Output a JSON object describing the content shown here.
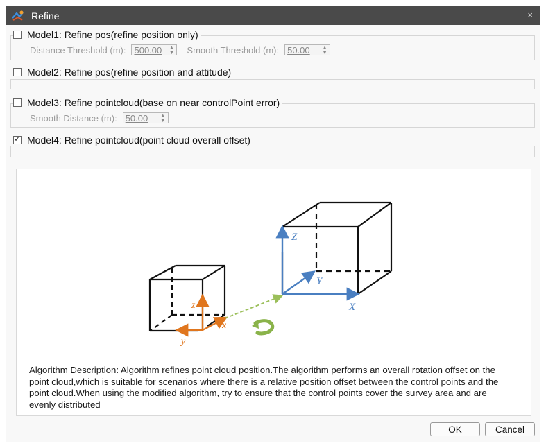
{
  "window": {
    "title": "Refine",
    "close_glyph": "×"
  },
  "models": [
    {
      "label": "Model1: Refine pos(refine position only)",
      "checked": false
    },
    {
      "label": "Model2: Refine pos(refine position and attitude)",
      "checked": false
    },
    {
      "label": "Model3: Refine pointcloud(base on near controlPoint error)",
      "checked": false
    },
    {
      "label": "Model4: Refine pointcloud(point cloud overall offset)",
      "checked": true
    }
  ],
  "model1": {
    "distance_label": "Distance Threshold (m):",
    "distance_value": "500.00",
    "smooth_label": "Smooth Threshold (m):",
    "smooth_value": "50.00"
  },
  "model3": {
    "smooth_distance_label": "Smooth Distance (m):",
    "smooth_distance_value": "50.00"
  },
  "diagram": {
    "large_cube_axes": {
      "x": "X",
      "y": "Y",
      "z": "Z",
      "color": "#4a7fc1"
    },
    "small_cube_axes": {
      "x": "x",
      "y": "y",
      "z": "z",
      "color": "#e0761e"
    },
    "offset_arrow_color": "#9bbf5a",
    "rotation_icon": "curved-arrow-icon"
  },
  "description": "Algorithm Description: Algorithm refines point cloud position.The algorithm performs an overall rotation offset on the point cloud,which is suitable for scenarios where there is a relative position offset between the control points and the point cloud.When using the modified algorithm, try to ensure that the control points cover the survey area and are evenly distributed",
  "buttons": {
    "ok": "OK",
    "cancel": "Cancel"
  }
}
